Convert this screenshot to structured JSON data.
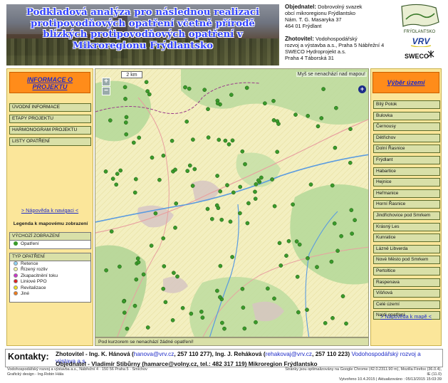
{
  "header": {
    "banner_title": "Podkladová analýza pro následnou realizaci protipovodňových opatření včetně přírodě blízkých protipovodňových opatření v Mikroregionu Frýdlantsko",
    "objednatel": {
      "label": "Objednatel:",
      "line1": " Dobrovolný svazek",
      "line2": "obcí mikroregionu Frýdlantsko",
      "line3": "Nám. T. G. Masaryka 37",
      "line4": "464 01 Frýdlant"
    },
    "zhotovitel": {
      "label": "Zhotovitel:",
      "line1": " Vodohospodářský",
      "line2": "rozvoj a výstavba a.s., Praha 5 Nábřežní 4",
      "line3": "SWECO Hydroprojekt a.s.",
      "line4": "Praha 4 Táborská 31"
    },
    "logos": {
      "frydlantsko": "FRÝDLANTSKO",
      "vrv": "VRV",
      "sweco": "SWECO"
    }
  },
  "left_panel": {
    "title": "INFORMACE O PROJEKTU",
    "nav": [
      "ÚVODNÍ INFORMACE",
      "ETAPY PROJEKTU",
      "HARMONOGRAM PROJEKTU",
      "LISTY OPATŘENÍ"
    ],
    "help_link": "> Nápověda k navigaci <",
    "legend_title": "Legenda k mapovému zobrazení",
    "legend_default": {
      "header": "VÝCHOZÍ ZOBRAZENÍ",
      "item": "Opatření"
    },
    "legend_types": {
      "header": "TYP OPATŘENÍ",
      "items": [
        {
          "label": "Retence",
          "color": "#8fd3f5"
        },
        {
          "label": "Řízený rozliv",
          "color": "#f2f2a0"
        },
        {
          "label": "Zkapacitnění toku",
          "color": "#cc33cc"
        },
        {
          "label": "Liniové PPO",
          "color": "#e02020"
        },
        {
          "label": "Revitalizace",
          "color": "#f0e020"
        },
        {
          "label": "Jiné",
          "color": "#f07a1a"
        }
      ]
    }
  },
  "map": {
    "scale": "2 km",
    "mouse_status": "Myš se nenachází nad mapou!",
    "zoom_in": "+",
    "zoom_out": "−",
    "layers": "+",
    "cursor_status": "Pod kurzorem se nenachází žádné opatření!",
    "marker_color": "#3a9a2a"
  },
  "right_panel": {
    "title": "Výběr území",
    "areas": [
      "Bílý Potok",
      "Bulovka",
      "Černousy",
      "Dětřichov",
      "Dolní Řasnice",
      "Frýdlant",
      "Habartice",
      "Hejnice",
      "Heřmanice",
      "Horní Řasnice",
      "Jindřichovice pod Smrkem",
      "Krásný Les",
      "Kunratice",
      "Lázně Libverda",
      "Nové Město pod Smrkem",
      "Pertoltice",
      "Raspenava",
      "Višňová",
      "Celé území",
      "Najdi opatření"
    ],
    "help_link": "> Nápověda k mapě <"
  },
  "contacts": {
    "label": "Kontakty:",
    "line1_pre": "Zhotovitel - Ing. K. Hánová (",
    "line1_email1": "hanova@vrv.cz",
    "line1_mid": ", 257 110 277),  Ing. J. Reháková (",
    "line1_email2": "rehakovaj@vrv.cz",
    "line1_post": ", 257 110 223) ",
    "line1_org": "Vodohospodářský rozvoj a výstava a.s.",
    "line2": "Objednatel - Vladimír Stibůrny (hamarce@volny.cz, tel.: 482 317 119) Mikroregion Frýdlantsko"
  },
  "footer": {
    "left1": "Vodohospodářský rozvoj a výstavba a.s., Nábřežní 4 · 150 56 Praha 5 · Smíchov",
    "left2": "Grafický design - Ing.Robin Hála",
    "right1": "Stránky jsou optimalizovány na Google Chrome (42.0.2311.90 m), Mozilla Firefox (36.0.4), IE (11.0)",
    "right2": "Vytvořeno 10.4.2015   |   Aktualizováno : 05/13/2015 15:03:39"
  }
}
